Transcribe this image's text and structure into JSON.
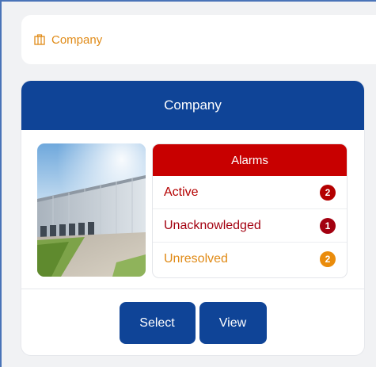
{
  "breadcrumb": {
    "icon": "building-icon",
    "label": "Company"
  },
  "card": {
    "title": "Company",
    "photo": "warehouse-building-photo",
    "alarms": {
      "title": "Alarms",
      "items": [
        {
          "label": "Active",
          "count": "2",
          "label_color": "#b40000",
          "badge_color": "#b40000"
        },
        {
          "label": "Unacknowledged",
          "count": "1",
          "label_color": "#a30010",
          "badge_color": "#a30010"
        },
        {
          "label": "Unresolved",
          "count": "2",
          "label_color": "#e08a16",
          "badge_color": "#ea8c0c"
        }
      ]
    },
    "buttons": {
      "select": "Select",
      "view": "View"
    }
  },
  "colors": {
    "primary": "#0f4497",
    "alarm_header": "#c80000",
    "accent": "#e08a16",
    "page_background": "#f1f2f4"
  }
}
